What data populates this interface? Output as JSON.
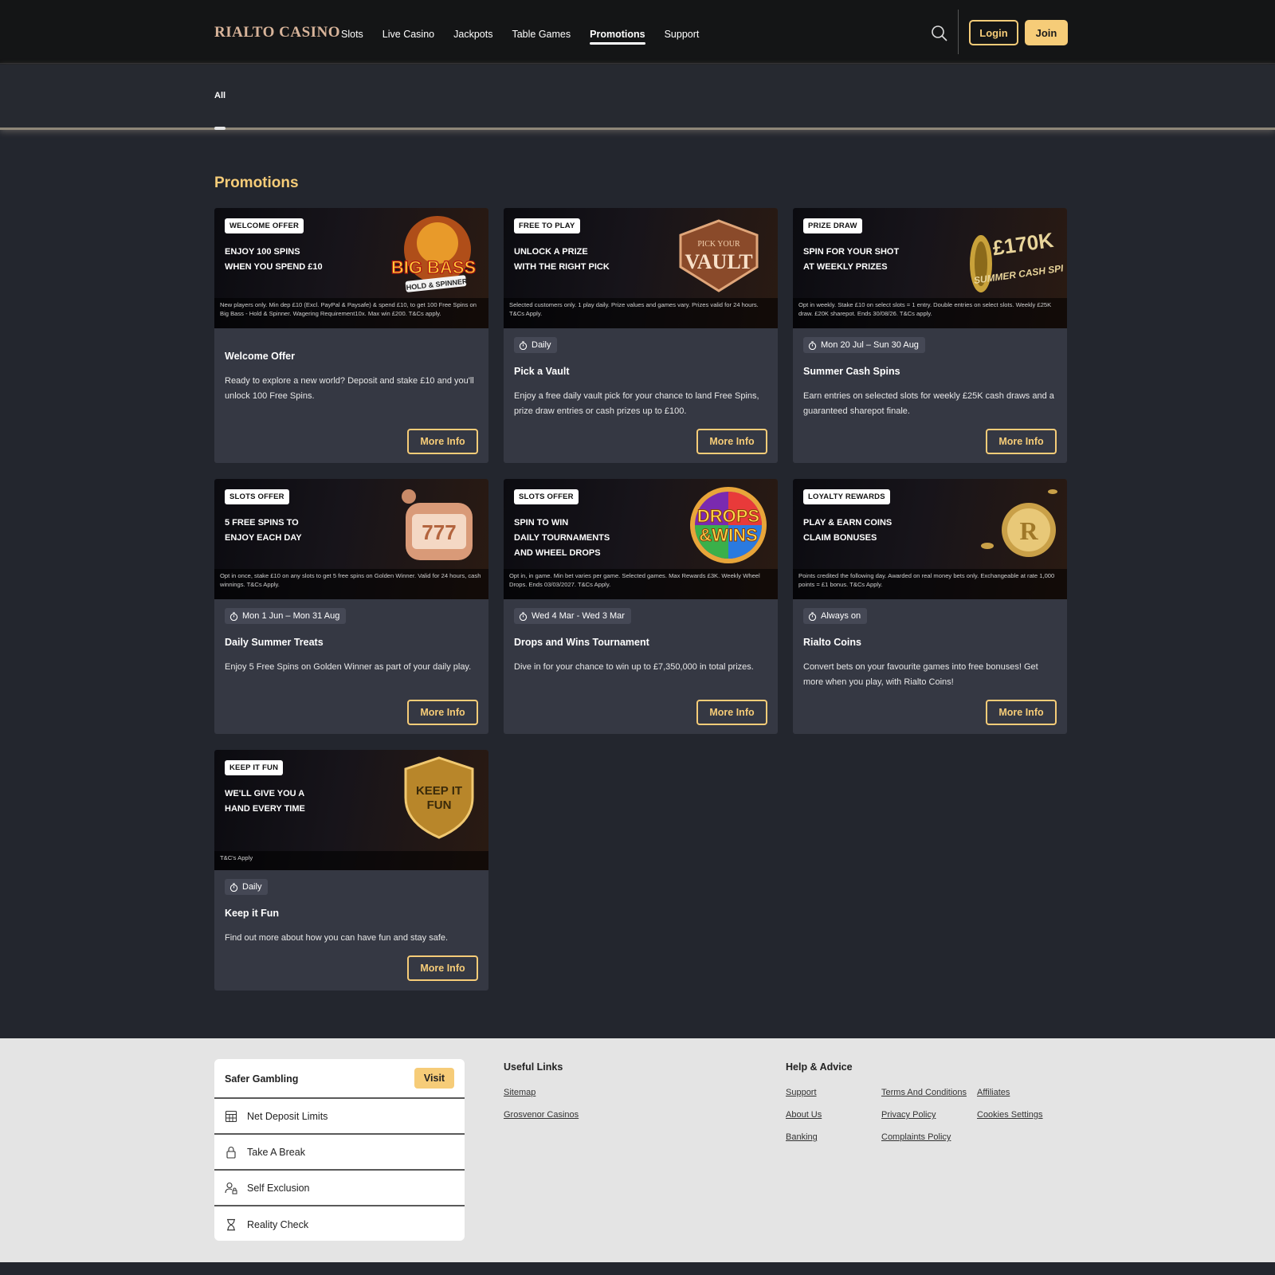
{
  "header": {
    "logo": "RIALTO CASINO",
    "nav": [
      "Slots",
      "Live Casino",
      "Jackpots",
      "Table Games",
      "Promotions",
      "Support"
    ],
    "active_nav": "Promotions",
    "login_label": "Login",
    "join_label": "Join"
  },
  "filters": {
    "all_label": "All"
  },
  "section_title": "Promotions",
  "cards": [
    {
      "tag": "WELCOME OFFER",
      "headline": "ENJOY 100 SPINS\nWHEN YOU SPEND £10",
      "art_text": "BIG BASS",
      "art_sub": "HOLD & SPINNER",
      "terms": "New players only. Min dep £10 (Excl. PayPal & Paysafe) & spend £10, to get 100 Free Spins on Big Bass - Hold & Spinner. Wagering Requirement10x. Max win £200. T&Cs apply.",
      "chip": "",
      "title": "Welcome Offer",
      "desc": "Ready to explore a new world? Deposit and stake £10 and you'll unlock 100 Free Spins.",
      "button": "More Info"
    },
    {
      "tag": "FREE TO PLAY",
      "headline": "UNLOCK A PRIZE\nWITH THE RIGHT PICK",
      "art_text": "VAULT",
      "art_sub": "PICK YOUR",
      "terms": "Selected customers only. 1 play daily. Prize values and games vary. Prizes valid for 24 hours. T&Cs Apply.",
      "chip": "Daily",
      "title": "Pick a Vault",
      "desc": "Enjoy a free daily vault pick for your chance to land Free Spins, prize draw entries or cash prizes up to £100.",
      "button": "More Info"
    },
    {
      "tag": "PRIZE DRAW",
      "headline": "SPIN FOR YOUR SHOT\nAT WEEKLY PRIZES",
      "art_text": "£170K",
      "art_sub": "SUMMER CASH SPINS",
      "terms": "Opt in weekly. Stake £10 on select slots = 1 entry. Double entries on select slots. Weekly £25K draw. £20K sharepot. Ends 30/08/26. T&Cs apply.",
      "chip": "Mon 20 Jul – Sun 30 Aug",
      "title": "Summer Cash Spins",
      "desc": "Earn entries on selected slots for weekly £25K cash draws and a guaranteed sharepot finale.",
      "button": "More Info"
    },
    {
      "tag": "SLOTS OFFER",
      "headline": "5 FREE SPINS TO\nENJOY EACH DAY",
      "art_text": "777",
      "art_sub": "",
      "terms": "Opt in once, stake £10 on any slots to get 5 free spins on Golden Winner. Valid for 24 hours, cash winnings. T&Cs Apply.",
      "chip": "Mon 1 Jun – Mon 31 Aug",
      "title": "Daily Summer Treats",
      "desc": "Enjoy 5 Free Spins on Golden Winner as part of your daily play.",
      "button": "More Info"
    },
    {
      "tag": "SLOTS OFFER",
      "headline": "SPIN TO WIN\nDAILY TOURNAMENTS\nAND WHEEL DROPS",
      "art_text": "DROPS",
      "art_sub": "&WINS",
      "terms": "Opt in, in game. Min bet varies per game. Selected games. Max Rewards £3K. Weekly Wheel Drops. Ends 03/03/2027. T&Cs Apply.",
      "chip": "Wed 4 Mar - Wed 3 Mar",
      "title": "Drops and Wins Tournament",
      "desc": "Dive in for your chance to win up to £7,350,000 in total prizes.",
      "button": "More Info"
    },
    {
      "tag": "LOYALTY REWARDS",
      "headline": "PLAY & EARN COINS\nCLAIM BONUSES",
      "art_text": "R",
      "art_sub": "",
      "terms": "Points credited the following day. Awarded on real money bets only. Exchangeable at rate 1,000 points = £1 bonus. T&Cs Apply.",
      "chip": "Always on",
      "title": "Rialto Coins",
      "desc": "Convert bets on your favourite games into free bonuses! Get more when you play, with Rialto Coins!",
      "button": "More Info"
    },
    {
      "tag": "KEEP IT FUN",
      "headline": "WE'LL GIVE YOU A\nHAND EVERY TIME",
      "art_text": "KEEP IT",
      "art_sub": "FUN",
      "terms": "T&C's Apply",
      "chip": "Daily",
      "title": "Keep it Fun",
      "desc": "Find out more about how you can have fun and stay safe.",
      "button": "More Info"
    }
  ],
  "footer": {
    "safer": {
      "title": "Safer Gambling",
      "visit": "Visit",
      "items": [
        {
          "label": "Net Deposit Limits",
          "icon": "calculator-icon"
        },
        {
          "label": "Take A Break",
          "icon": "lock-icon"
        },
        {
          "label": "Self Exclusion",
          "icon": "user-lock-icon"
        },
        {
          "label": "Reality Check",
          "icon": "hourglass-icon"
        }
      ]
    },
    "useful_title": "Useful Links",
    "useful_links": [
      "Sitemap",
      "Grosvenor Casinos"
    ],
    "help_title": "Help & Advice",
    "help_links": [
      "Support",
      "About Us",
      "Banking",
      "Terms And Conditions",
      "Privacy Policy",
      "Complaints Policy",
      "Affiliates",
      "Cookies Settings"
    ]
  },
  "colors": {
    "accent": "#f6cc78",
    "page_bg": "#23262e",
    "card_bg": "#353843",
    "footer_bg": "#e4e4e4"
  }
}
